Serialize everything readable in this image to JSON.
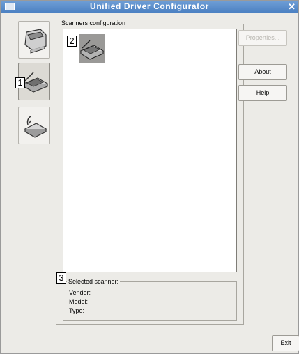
{
  "window": {
    "title": "Unified Driver Configurator",
    "close_glyph": "✕"
  },
  "nav": [
    {
      "name": "printers",
      "icon": "printer-icon"
    },
    {
      "name": "scanners",
      "icon": "scanner-icon",
      "active": true
    },
    {
      "name": "ports",
      "icon": "port-icon"
    }
  ],
  "callouts": {
    "c1": "1",
    "c2": "2",
    "c3": "3"
  },
  "scanners_group": {
    "label": "Scanners configuration"
  },
  "selected_scanner": {
    "label": "Selected scanner:",
    "vendor_label": "Vendor:",
    "model_label": "Model:",
    "type_label": "Type:"
  },
  "buttons": {
    "properties": "Properties...",
    "about": "About",
    "help": "Help",
    "exit": "Exit"
  },
  "colors": {
    "titlebar": "#4a7fc1",
    "window_bg": "#ecebe7"
  }
}
